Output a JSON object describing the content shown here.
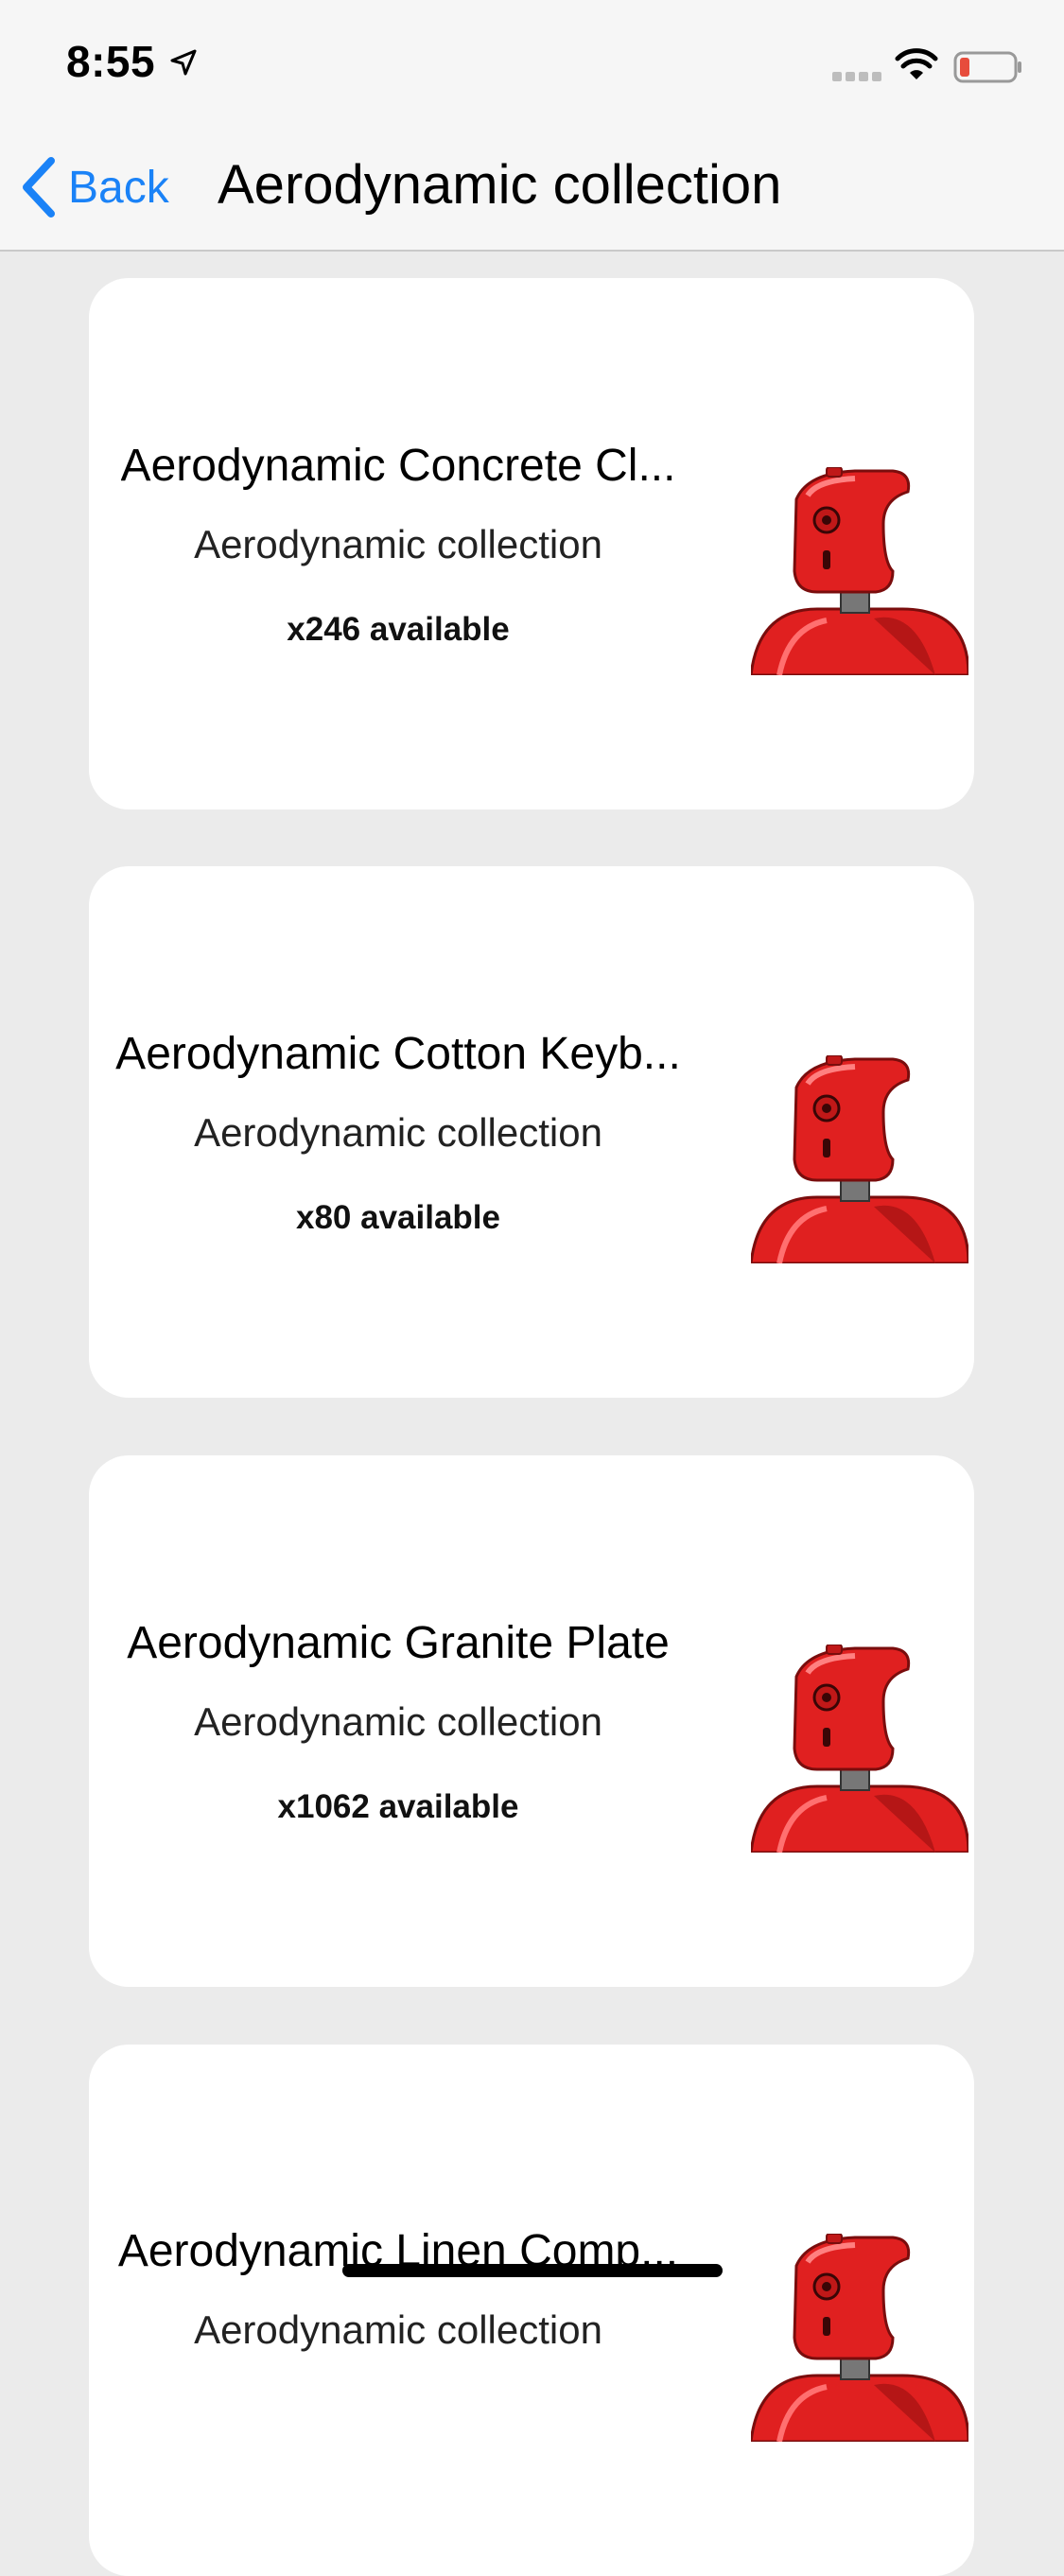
{
  "status": {
    "time": "8:55",
    "icons": [
      "location-arrow-icon",
      "signal-icon",
      "wifi-icon",
      "battery-icon"
    ],
    "battery_color": "#e74c3c"
  },
  "nav": {
    "back_label": "Back",
    "title": "Aerodynamic collection",
    "accent": "#1a82f7"
  },
  "items": [
    {
      "title": "Aerodynamic Concrete Cl...",
      "subtitle": "Aerodynamic collection",
      "availability": "x246 available"
    },
    {
      "title": "Aerodynamic Cotton Keyb...",
      "subtitle": "Aerodynamic collection",
      "availability": "x80 available"
    },
    {
      "title": "Aerodynamic Granite Plate",
      "subtitle": "Aerodynamic collection",
      "availability": "x1062 available"
    },
    {
      "title": "Aerodynamic Linen Comp...",
      "subtitle": "Aerodynamic collection",
      "availability": ""
    }
  ]
}
